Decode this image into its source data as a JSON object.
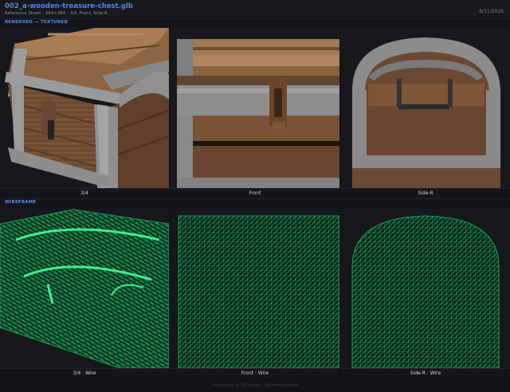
{
  "header": {
    "title": "002_a-wooden-treasure-chest.glb",
    "subtitle": "Reference Sheet · 384×384 · 3/4, Front, Side-R",
    "date": "8/11/2026"
  },
  "sections": {
    "textured_label": "RENDERED — TEXTURED",
    "wireframe_label": "WIREFRAME"
  },
  "textured_views": [
    {
      "label": "3/4"
    },
    {
      "label": "Front"
    },
    {
      "label": "Side-R"
    }
  ],
  "wire_views": [
    {
      "label": "3/4 · Wire"
    },
    {
      "label": "Front · Wire"
    },
    {
      "label": "Side-R · Wire"
    }
  ],
  "footer": "Generated by 3D Viewer · Reference Sheet",
  "colors": {
    "wood": "#7a5236",
    "wood_light": "#a27650",
    "metal": "#8a8a8a",
    "wire": "#1fc46c",
    "accent": "#4f86e8"
  }
}
